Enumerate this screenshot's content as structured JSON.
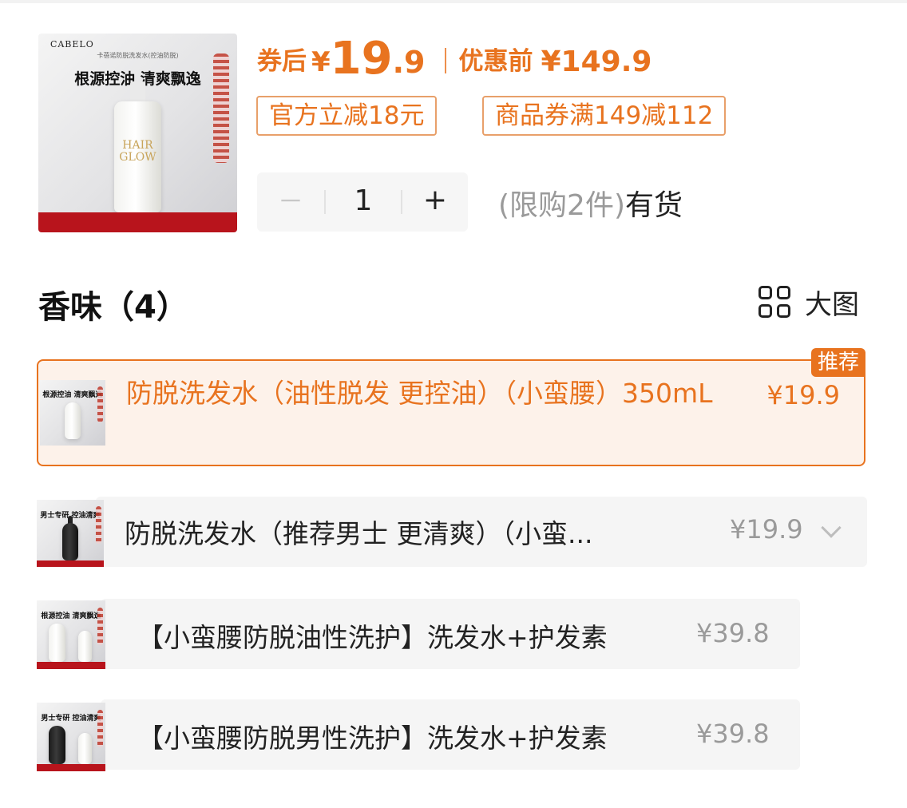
{
  "product": {
    "image_brand": "CABELO",
    "image_subtitle": "卡蓓诺防脱洗发水(控油防脱)",
    "image_tagline": "根源控油 清爽飘逸",
    "image_bottle_label": "HAIR GLOW"
  },
  "price": {
    "after_coupon_label": "券后",
    "currency": "¥",
    "after_coupon_int": "19",
    "after_coupon_dec": ".9",
    "before_label": "优惠前",
    "before_value": "¥149.9",
    "accent_color": "#e8731f"
  },
  "coupons": [
    "官方立减18元",
    "商品券满149减112"
  ],
  "quantity": {
    "minus": "－",
    "value": "1",
    "plus": "+",
    "limit_text": "(限购2件)",
    "stock_text": "有货"
  },
  "section": {
    "title": "香味（4）",
    "view_label": "大图",
    "view_icon": "grid-icon"
  },
  "options": [
    {
      "name": "防脱洗发水（油性脱发  更控油）（小蛮腰）350mL",
      "price": "¥19.9",
      "badge": "推荐",
      "selected": true,
      "thumb_tagline": "根源控油 清爽飘逸"
    },
    {
      "name": "防脱洗发水（推荐男士 更清爽）（小蛮...",
      "price": "¥19.9",
      "selected": false,
      "thumb_tagline": "男士专研 控油清爽"
    },
    {
      "name": "【小蛮腰防脱油性洗护】洗发水+护发素",
      "price": "¥39.8",
      "selected": false,
      "thumb_tagline": "根源控油 清爽飘逸"
    },
    {
      "name": "【小蛮腰防脱男性洗护】洗发水+护发素",
      "price": "¥39.8",
      "selected": false,
      "thumb_tagline": "男士专研 控油清爽"
    }
  ]
}
